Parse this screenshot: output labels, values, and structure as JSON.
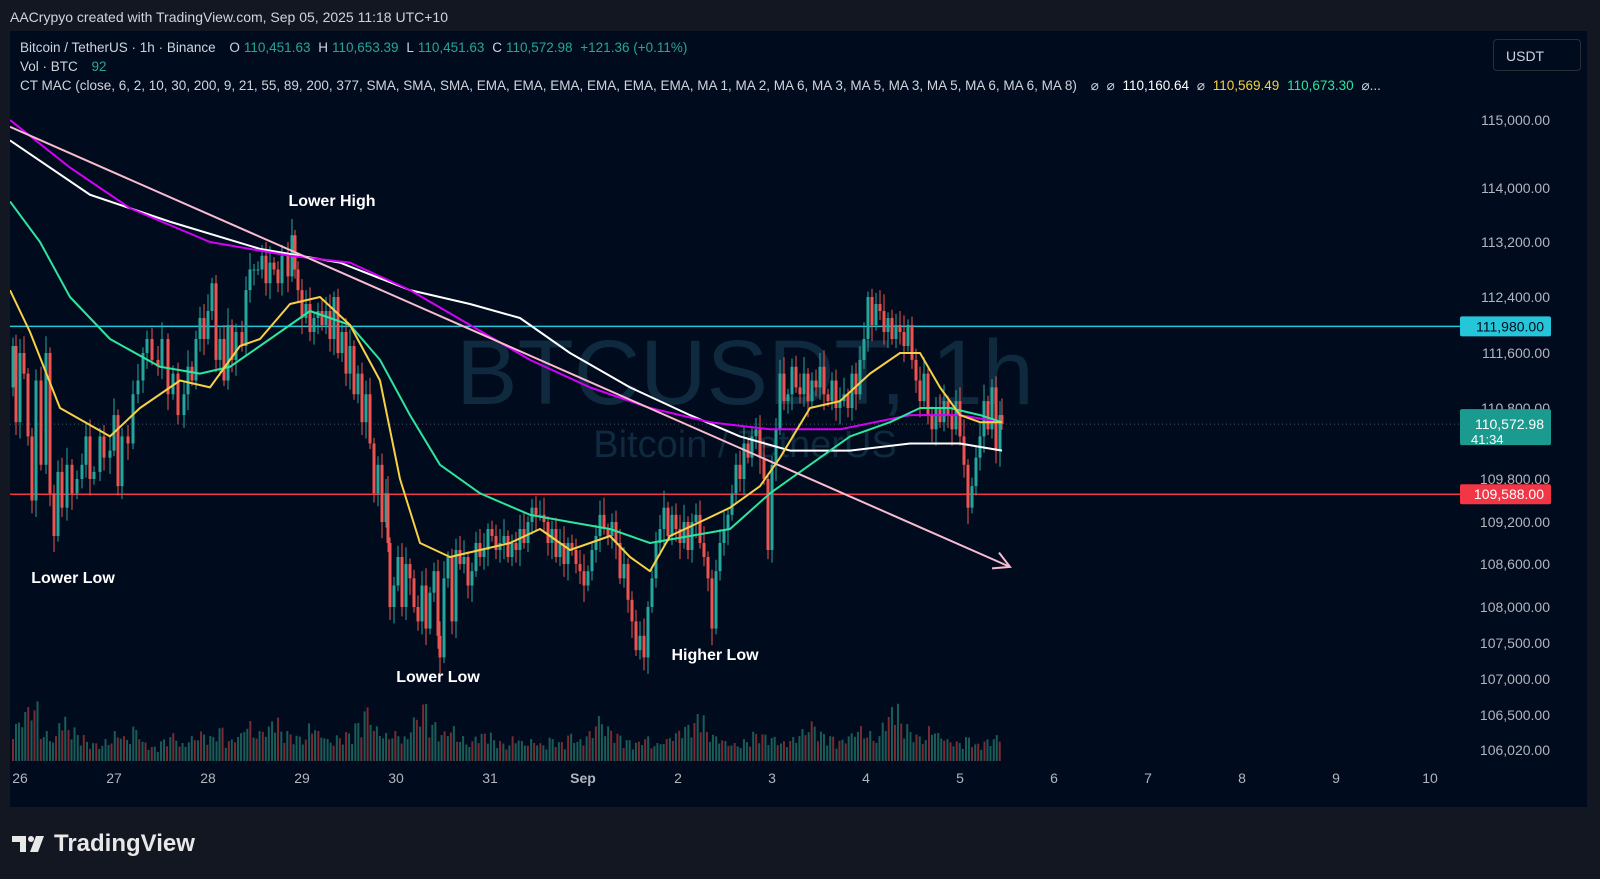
{
  "caption": "AACrypyo created with TradingView.com, Sep 05, 2025 11:18 UTC+10",
  "legend": {
    "symbol": "Bitcoin / TetherUS · 1h · Binance",
    "o_label": "O",
    "o_val": "110,451.63",
    "h_label": "H",
    "h_val": "110,653.39",
    "l_label": "L",
    "l_val": "110,451.63",
    "c_label": "C",
    "c_val": "110,572.98",
    "change": "+121.36 (+0.11%)",
    "vol_label": "Vol · BTC",
    "vol_val": "92",
    "ind_label": "CT MAC (close, 6, 2, 10, 30, 200, 9, 21, 55, 89, 200, 377, SMA, SMA, SMA, EMA, EMA, EMA, EMA, EMA, EMA, MA 1, MA 2, MA 6, MA 3, MA 5, MA 3, MA 5, MA 6, MA 6, MA 8)",
    "ind_sym1": "⌀",
    "ind_sym2": "⌀",
    "ind_v1": "110,160.64",
    "ind_sym3": "⌀",
    "ind_v2": "110,569.49",
    "ind_v3": "110,673.30",
    "ind_more": "⌀..."
  },
  "currency": "USDT",
  "watermark": {
    "main": "BTCUSDT, 1h",
    "sub": "Bitcoin / TetherUS"
  },
  "footer_brand": "TradingView",
  "colors": {
    "bg": "#000b1d",
    "up": "#26a69a",
    "down": "#ef5350",
    "resistance": "#26c6da",
    "support": "#f23645",
    "trendline": "#f8bbd0",
    "ma_yellow": "#f7d046",
    "ma_green": "#2ee59d",
    "ma_magenta": "#d500f9",
    "ma_white": "#ffffff"
  },
  "chart_data": {
    "type": "candlestick",
    "title": "Bitcoin / TetherUS · 1h · Binance",
    "y_ticks": [
      "115,000.00",
      "114,000.00",
      "113,200.00",
      "112,400.00",
      "111,600.00",
      "110,800.00",
      "109,800.00",
      "109,200.00",
      "108,600.00",
      "108,000.00",
      "107,500.00",
      "107,000.00",
      "106,500.00",
      "106,020.00"
    ],
    "x_ticks": [
      "26",
      "27",
      "28",
      "29",
      "30",
      "31",
      "Sep",
      "2",
      "3",
      "4",
      "5",
      "6",
      "7",
      "8",
      "9",
      "10"
    ],
    "horizontal_levels": [
      {
        "price": 111980,
        "label": "111,980.00",
        "color": "#26c6da"
      },
      {
        "price": 109588,
        "label": "109,588.00",
        "color": "#f23645"
      }
    ],
    "last_price": {
      "label": "110,572.98",
      "countdown": "41:34"
    },
    "annotations": [
      "Lower High",
      "Lower Low",
      "Lower Low",
      "Higher Low"
    ],
    "close_path": [
      [
        0,
        111100
      ],
      [
        3,
        111700
      ],
      [
        6,
        110600
      ],
      [
        10,
        111600
      ],
      [
        14,
        111300
      ],
      [
        18,
        110400
      ],
      [
        22,
        109500
      ],
      [
        26,
        111200
      ],
      [
        31,
        110000
      ],
      [
        36,
        111600
      ],
      [
        40,
        109600
      ],
      [
        44,
        109000
      ],
      [
        48,
        109900
      ],
      [
        52,
        109400
      ],
      [
        57,
        110000
      ],
      [
        62,
        109600
      ],
      [
        67,
        109800
      ],
      [
        72,
        110000
      ],
      [
        76,
        110400
      ],
      [
        80,
        109800
      ],
      [
        84,
        109900
      ],
      [
        90,
        110400
      ],
      [
        94,
        110100
      ],
      [
        100,
        110200
      ],
      [
        104,
        110700
      ],
      [
        108,
        109700
      ],
      [
        112,
        110400
      ],
      [
        118,
        110300
      ],
      [
        123,
        111000
      ],
      [
        128,
        111200
      ],
      [
        133,
        111600
      ],
      [
        137,
        111800
      ],
      [
        142,
        111500
      ],
      [
        148,
        111400
      ],
      [
        152,
        111800
      ],
      [
        158,
        111000
      ],
      [
        163,
        111300
      ],
      [
        168,
        110700
      ],
      [
        174,
        111000
      ],
      [
        178,
        111400
      ],
      [
        182,
        111200
      ],
      [
        186,
        111800
      ],
      [
        190,
        112100
      ],
      [
        194,
        111800
      ],
      [
        198,
        112200
      ],
      [
        202,
        112600
      ],
      [
        206,
        111500
      ],
      [
        210,
        111800
      ],
      [
        214,
        111200
      ],
      [
        218,
        112000
      ],
      [
        222,
        111500
      ],
      [
        226,
        111900
      ],
      [
        232,
        111700
      ],
      [
        236,
        112500
      ],
      [
        240,
        112800
      ],
      [
        244,
        112800
      ],
      [
        248,
        112800
      ],
      [
        252,
        113000
      ],
      [
        256,
        112600
      ],
      [
        260,
        112900
      ],
      [
        264,
        112800
      ],
      [
        268,
        112600
      ],
      [
        272,
        113000
      ],
      [
        278,
        112700
      ],
      [
        282,
        113300
      ],
      [
        285,
        112800
      ],
      [
        288,
        112500
      ],
      [
        292,
        112100
      ],
      [
        296,
        112300
      ],
      [
        300,
        111900
      ],
      [
        304,
        112100
      ],
      [
        308,
        112200
      ],
      [
        312,
        112000
      ],
      [
        316,
        112200
      ],
      [
        320,
        111800
      ],
      [
        324,
        112400
      ],
      [
        328,
        111600
      ],
      [
        332,
        111900
      ],
      [
        336,
        111300
      ],
      [
        340,
        111700
      ],
      [
        344,
        111000
      ],
      [
        348,
        111300
      ],
      [
        352,
        110600
      ],
      [
        356,
        111000
      ],
      [
        360,
        110300
      ],
      [
        364,
        109600
      ],
      [
        368,
        110000
      ],
      [
        372,
        109200
      ],
      [
        376,
        109600
      ],
      [
        378,
        108900
      ],
      [
        380,
        108000
      ],
      [
        384,
        108300
      ],
      [
        388,
        108700
      ],
      [
        392,
        108000
      ],
      [
        396,
        108600
      ],
      [
        400,
        108400
      ],
      [
        404,
        108000
      ],
      [
        408,
        107800
      ],
      [
        412,
        108300
      ],
      [
        416,
        107700
      ],
      [
        420,
        108200
      ],
      [
        424,
        108500
      ],
      [
        428,
        107600
      ],
      [
        430,
        107300
      ],
      [
        434,
        108400
      ],
      [
        438,
        108700
      ],
      [
        442,
        107800
      ],
      [
        446,
        108800
      ],
      [
        450,
        108600
      ],
      [
        454,
        108700
      ],
      [
        458,
        108300
      ],
      [
        462,
        108500
      ],
      [
        466,
        108900
      ],
      [
        470,
        108700
      ],
      [
        474,
        108800
      ],
      [
        478,
        109100
      ],
      [
        482,
        109000
      ],
      [
        486,
        108800
      ],
      [
        490,
        108900
      ],
      [
        494,
        109000
      ],
      [
        498,
        108700
      ],
      [
        502,
        108900
      ],
      [
        506,
        108800
      ],
      [
        510,
        109100
      ],
      [
        514,
        108900
      ],
      [
        518,
        109200
      ],
      [
        522,
        109400
      ],
      [
        526,
        109300
      ],
      [
        530,
        109300
      ],
      [
        534,
        109200
      ],
      [
        538,
        108900
      ],
      [
        542,
        109100
      ],
      [
        546,
        108700
      ],
      [
        550,
        108900
      ],
      [
        554,
        108600
      ],
      [
        558,
        108900
      ],
      [
        562,
        108800
      ],
      [
        566,
        108600
      ],
      [
        570,
        108500
      ],
      [
        574,
        108300
      ],
      [
        578,
        108500
      ],
      [
        582,
        108800
      ],
      [
        586,
        109000
      ],
      [
        590,
        109300
      ],
      [
        594,
        109100
      ],
      [
        598,
        109000
      ],
      [
        602,
        109200
      ],
      [
        606,
        108900
      ],
      [
        610,
        108400
      ],
      [
        614,
        108600
      ],
      [
        618,
        108100
      ],
      [
        622,
        107800
      ],
      [
        626,
        107400
      ],
      [
        630,
        107600
      ],
      [
        634,
        107300
      ],
      [
        638,
        108000
      ],
      [
        642,
        108400
      ],
      [
        646,
        108900
      ],
      [
        650,
        109100
      ],
      [
        654,
        109400
      ],
      [
        658,
        109000
      ],
      [
        662,
        109300
      ],
      [
        666,
        109100
      ],
      [
        670,
        108900
      ],
      [
        674,
        109200
      ],
      [
        678,
        108800
      ],
      [
        682,
        109200
      ],
      [
        686,
        109300
      ],
      [
        690,
        108900
      ],
      [
        694,
        108700
      ],
      [
        698,
        108400
      ],
      [
        702,
        107700
      ],
      [
        706,
        108500
      ],
      [
        710,
        108900
      ],
      [
        714,
        109100
      ],
      [
        718,
        109300
      ],
      [
        722,
        109600
      ],
      [
        726,
        110000
      ],
      [
        730,
        109800
      ],
      [
        734,
        110300
      ],
      [
        738,
        110100
      ],
      [
        742,
        110400
      ],
      [
        746,
        110500
      ],
      [
        750,
        110100
      ],
      [
        754,
        109800
      ],
      [
        758,
        108800
      ],
      [
        762,
        110000
      ],
      [
        766,
        110500
      ],
      [
        770,
        111300
      ],
      [
        774,
        110900
      ],
      [
        778,
        111000
      ],
      [
        782,
        111400
      ],
      [
        786,
        111100
      ],
      [
        790,
        111000
      ],
      [
        794,
        111300
      ],
      [
        798,
        110900
      ],
      [
        802,
        111200
      ],
      [
        806,
        111100
      ],
      [
        810,
        111400
      ],
      [
        814,
        111000
      ],
      [
        818,
        110900
      ],
      [
        822,
        111200
      ],
      [
        826,
        110800
      ],
      [
        830,
        110900
      ],
      [
        834,
        111000
      ],
      [
        838,
        110800
      ],
      [
        842,
        111300
      ],
      [
        846,
        111000
      ],
      [
        850,
        111500
      ],
      [
        854,
        111800
      ],
      [
        858,
        112400
      ],
      [
        862,
        112000
      ],
      [
        866,
        112300
      ],
      [
        870,
        112200
      ],
      [
        874,
        111900
      ],
      [
        878,
        112100
      ],
      [
        882,
        111800
      ],
      [
        886,
        112000
      ],
      [
        890,
        111900
      ],
      [
        894,
        111700
      ],
      [
        898,
        112000
      ],
      [
        902,
        111500
      ],
      [
        906,
        111200
      ],
      [
        910,
        110900
      ],
      [
        914,
        111300
      ],
      [
        918,
        110700
      ],
      [
        922,
        110500
      ],
      [
        926,
        110800
      ],
      [
        930,
        110600
      ],
      [
        934,
        110900
      ],
      [
        938,
        110700
      ],
      [
        942,
        110500
      ],
      [
        946,
        110900
      ],
      [
        950,
        110400
      ],
      [
        954,
        110000
      ],
      [
        958,
        109400
      ],
      [
        962,
        109700
      ],
      [
        966,
        110100
      ],
      [
        970,
        110400
      ],
      [
        974,
        110900
      ],
      [
        978,
        110500
      ],
      [
        982,
        111100
      ],
      [
        986,
        110200
      ],
      [
        990,
        110700
      ],
      [
        992,
        110573
      ]
    ],
    "ma_yellow": [
      [
        0,
        112500
      ],
      [
        20,
        111900
      ],
      [
        50,
        110800
      ],
      [
        100,
        110400
      ],
      [
        130,
        110800
      ],
      [
        170,
        111200
      ],
      [
        200,
        111100
      ],
      [
        230,
        111700
      ],
      [
        250,
        111800
      ],
      [
        280,
        112300
      ],
      [
        310,
        112400
      ],
      [
        340,
        112000
      ],
      [
        370,
        111200
      ],
      [
        390,
        109800
      ],
      [
        410,
        108900
      ],
      [
        440,
        108700
      ],
      [
        470,
        108800
      ],
      [
        500,
        108900
      ],
      [
        530,
        109100
      ],
      [
        560,
        108800
      ],
      [
        600,
        109000
      ],
      [
        620,
        108700
      ],
      [
        640,
        108500
      ],
      [
        660,
        109000
      ],
      [
        690,
        109200
      ],
      [
        720,
        109400
      ],
      [
        750,
        109700
      ],
      [
        770,
        110100
      ],
      [
        800,
        110800
      ],
      [
        830,
        110900
      ],
      [
        860,
        111300
      ],
      [
        890,
        111600
      ],
      [
        910,
        111600
      ],
      [
        930,
        111100
      ],
      [
        950,
        110700
      ],
      [
        970,
        110600
      ],
      [
        992,
        110600
      ]
    ],
    "ma_green": [
      [
        0,
        113800
      ],
      [
        30,
        113200
      ],
      [
        60,
        112400
      ],
      [
        100,
        111800
      ],
      [
        150,
        111400
      ],
      [
        190,
        111300
      ],
      [
        220,
        111400
      ],
      [
        260,
        111800
      ],
      [
        300,
        112200
      ],
      [
        340,
        112000
      ],
      [
        370,
        111500
      ],
      [
        400,
        110700
      ],
      [
        430,
        110000
      ],
      [
        470,
        109600
      ],
      [
        520,
        109300
      ],
      [
        560,
        109200
      ],
      [
        600,
        109100
      ],
      [
        640,
        108900
      ],
      [
        680,
        109000
      ],
      [
        720,
        109100
      ],
      [
        760,
        109600
      ],
      [
        800,
        110000
      ],
      [
        840,
        110400
      ],
      [
        880,
        110600
      ],
      [
        910,
        110800
      ],
      [
        940,
        110800
      ],
      [
        970,
        110700
      ],
      [
        992,
        110600
      ]
    ],
    "ma_magenta": [
      [
        0,
        115000
      ],
      [
        60,
        114300
      ],
      [
        120,
        113700
      ],
      [
        200,
        113200
      ],
      [
        280,
        113000
      ],
      [
        340,
        112900
      ],
      [
        400,
        112500
      ],
      [
        460,
        112000
      ],
      [
        520,
        111500
      ],
      [
        580,
        111100
      ],
      [
        640,
        110800
      ],
      [
        700,
        110600
      ],
      [
        760,
        110500
      ],
      [
        830,
        110500
      ],
      [
        900,
        110700
      ],
      [
        950,
        110700
      ],
      [
        992,
        110600
      ]
    ],
    "ma_white": [
      [
        0,
        114700
      ],
      [
        80,
        113900
      ],
      [
        160,
        113500
      ],
      [
        250,
        113100
      ],
      [
        330,
        112900
      ],
      [
        400,
        112500
      ],
      [
        460,
        112300
      ],
      [
        510,
        112100
      ],
      [
        560,
        111600
      ],
      [
        620,
        111100
      ],
      [
        680,
        110700
      ],
      [
        730,
        110400
      ],
      [
        780,
        110200
      ],
      [
        840,
        110200
      ],
      [
        900,
        110300
      ],
      [
        950,
        110300
      ],
      [
        992,
        110200
      ]
    ],
    "trendline": {
      "from": [
        0,
        114900
      ],
      "to": [
        1000,
        108560
      ]
    },
    "volume": [
      40,
      55,
      60,
      30,
      25,
      45,
      35,
      28,
      20,
      18,
      22,
      30,
      25,
      35,
      20,
      15,
      22,
      28,
      18,
      25,
      30,
      26,
      35,
      22,
      28,
      40,
      30,
      35,
      45,
      32,
      28,
      25,
      38,
      30,
      22,
      26,
      30,
      40,
      55,
      35,
      28,
      30,
      25,
      45,
      60,
      40,
      30,
      35,
      25,
      20,
      28,
      30,
      22,
      18,
      25,
      20,
      22,
      18,
      24,
      20,
      28,
      22,
      30,
      45,
      35,
      28,
      22,
      20,
      25,
      18,
      22,
      28,
      35,
      40,
      50,
      30,
      25,
      20,
      18,
      22,
      30,
      28,
      25,
      20,
      24,
      32,
      40,
      30,
      26,
      22,
      28,
      35,
      30,
      25,
      45,
      60,
      40,
      30,
      25,
      35,
      28,
      22,
      20,
      25,
      18,
      22,
      26
    ]
  }
}
